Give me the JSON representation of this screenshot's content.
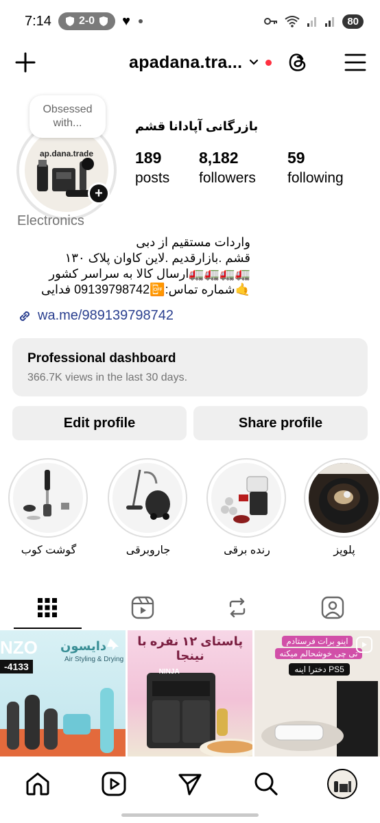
{
  "status_bar": {
    "time": "7:14",
    "score": "2-0",
    "battery": "80"
  },
  "header": {
    "username": "apadana.tra...",
    "has_notification_dot": true
  },
  "profile": {
    "note": "Obsessed with...",
    "avatar_brand": "ap.dana.trade",
    "display_name": "بازرگانی آپادانا قشم",
    "stats": {
      "posts": {
        "value": "189",
        "label": "posts"
      },
      "followers": {
        "value": "8,182",
        "label": "followers"
      },
      "following": {
        "value": "59",
        "label": "following"
      }
    },
    "category": "Electronics",
    "bio_lines": [
      "واردات مستقیم از دبی",
      "قشم .بازارقدیم .لاین کاوان پلاک ۱۳۰",
      "🚛🚛🚛🚛ارسال کالا به سراسر کشور",
      "🤙شماره تماس:📴09139798742 فدایی"
    ],
    "link": "wa.me/989139798742"
  },
  "dashboard": {
    "title": "Professional dashboard",
    "subtitle": "366.7K views in the last 30 days."
  },
  "actions": {
    "edit_label": "Edit profile",
    "share_label": "Share profile"
  },
  "highlights": [
    {
      "label": "گوشت کوب"
    },
    {
      "label": "جاروبرقی"
    },
    {
      "label": "رنده برقی"
    },
    {
      "label": "پلوپز"
    }
  ],
  "tabs": [
    "grid",
    "reels",
    "reposts",
    "tagged"
  ],
  "grid_posts": [
    {
      "text_top": "دایسون",
      "text_sub": "Air Styling & Drying",
      "text_code": "-4133",
      "brand_fragment": "NZO"
    },
    {
      "text_top": "پاستای ۱۲ نفره با نینجا",
      "brand": "NINJA"
    },
    {
      "text_top": "اینو برات فرستادم",
      "text_mid": "تی چی خوشحالم میکنه",
      "text_tag": "PS5 دخترا اینه"
    }
  ],
  "bottom_nav": [
    "home",
    "reels",
    "send",
    "search",
    "profile"
  ]
}
